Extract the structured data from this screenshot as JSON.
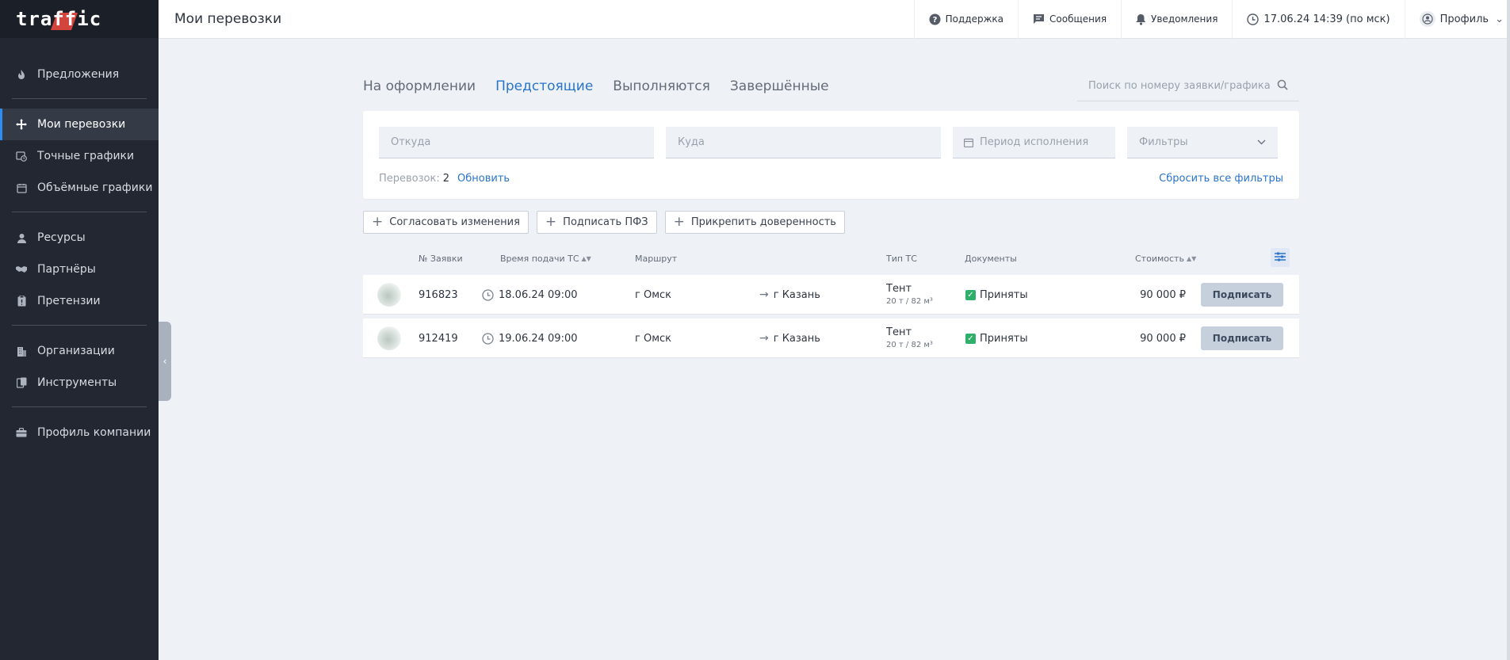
{
  "brand": {
    "logo_text": "traffic",
    "accent": "#e8483f"
  },
  "colors": {
    "sidebar_bg": "#222731",
    "link": "#2a74c9",
    "active_nav": "#2f8cf0",
    "success": "#2fb06a"
  },
  "sidebar": {
    "groups": [
      [
        {
          "label": "Предложения",
          "icon": "fire-icon"
        }
      ],
      [
        {
          "label": "Мои перевозки",
          "icon": "move-icon",
          "active": true
        },
        {
          "label": "Точные графики",
          "icon": "calendar-clock-icon"
        },
        {
          "label": "Объёмные графики",
          "icon": "calendar-icon"
        }
      ],
      [
        {
          "label": "Ресурсы",
          "icon": "user-icon"
        },
        {
          "label": "Партнёры",
          "icon": "handshake-icon"
        },
        {
          "label": "Претензии",
          "icon": "clipboard-icon"
        }
      ],
      [
        {
          "label": "Организации",
          "icon": "building-icon"
        },
        {
          "label": "Инструменты",
          "icon": "tools-icon"
        }
      ],
      [
        {
          "label": "Профиль компании",
          "icon": "briefcase-icon"
        }
      ]
    ]
  },
  "header": {
    "title": "Мои перевозки",
    "support": "Поддержка",
    "messages": "Сообщения",
    "notifications": "Уведомления",
    "datetime": "17.06.24 14:39 (по мск)",
    "profile": "Профиль"
  },
  "tabs": [
    {
      "label": "На оформлении",
      "active": false
    },
    {
      "label": "Предстоящие",
      "active": true
    },
    {
      "label": "Выполняются",
      "active": false
    },
    {
      "label": "Завершённые",
      "active": false
    }
  ],
  "search": {
    "placeholder": "Поиск по номеру заявки/графика"
  },
  "filters": {
    "from_placeholder": "Откуда",
    "to_placeholder": "Куда",
    "period_placeholder": "Период исполнения",
    "filters_label": "Фильтры",
    "count_label": "Перевозок:",
    "count_value": "2",
    "refresh": "Обновить",
    "reset_all": "Сбросить все фильтры"
  },
  "actions": {
    "approve_changes": "Согласовать изменения",
    "sign_pfz": "Подписать ПФЗ",
    "attach_poa": "Прикрепить доверенность"
  },
  "table": {
    "headers": {
      "order_no": "№ Заявки",
      "arrival_time": "Время подачи ТС",
      "route": "Маршрут",
      "vehicle_type": "Тип ТС",
      "documents": "Документы",
      "cost": "Стоимость"
    },
    "rows": [
      {
        "order_no": "916823",
        "time": "18.06.24 09:00",
        "from": "г Омск",
        "to": "г Казань",
        "vehicle": "Тент",
        "capacity": "20 т / 82 м³",
        "docs": "Приняты",
        "cost": "90 000 ₽",
        "action": "Подписать"
      },
      {
        "order_no": "912419",
        "time": "19.06.24 09:00",
        "from": "г Омск",
        "to": "г Казань",
        "vehicle": "Тент",
        "capacity": "20 т / 82 м³",
        "docs": "Приняты",
        "cost": "90 000 ₽",
        "action": "Подписать"
      }
    ]
  }
}
